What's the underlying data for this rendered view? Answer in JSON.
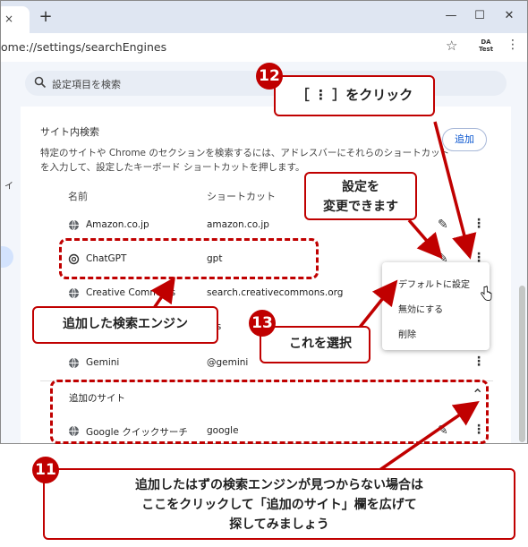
{
  "browser": {
    "url": "ome://settings/searchEngines",
    "new_tab": "+",
    "tab_close": "×",
    "window_controls": {
      "minimize": "—",
      "maximize": "☐",
      "close": "✕"
    },
    "extension_badge": "DA\nTest"
  },
  "search": {
    "placeholder": "設定項目を検索"
  },
  "sidebar_fragment": "イ",
  "site_search": {
    "title": "サイト内検索",
    "description": "特定のサイトや Chrome のセクションを検索するには、アドレスバーにそれらのショートカットを入力して、設定したキーボード ショートカットを押します。",
    "add_button": "追加",
    "columns": {
      "name": "名前",
      "shortcut": "ショートカット"
    },
    "rows": [
      {
        "name": "Amazon.co.jp",
        "shortcut": "amazon.co.jp",
        "icon": "globe-icon"
      },
      {
        "name": "ChatGPT",
        "shortcut": "gpt",
        "icon": "chatgpt-icon"
      },
      {
        "name": "Creative Commons",
        "shortcut": "search.creativecommons.org",
        "icon": "globe-icon"
      },
      {
        "name": "",
        "shortcut": "rds",
        "icon": "globe-icon"
      },
      {
        "name": "Gemini",
        "shortcut": "@gemini",
        "icon": "globe-icon"
      }
    ],
    "added_sites": {
      "header": "追加のサイト",
      "rows": [
        {
          "name": "Google クイックサーチ",
          "shortcut": "google",
          "icon": "globe-icon"
        }
      ]
    }
  },
  "context_menu": {
    "items": [
      "デフォルトに設定",
      "無効にする",
      "削除"
    ]
  },
  "annotations": {
    "n12": {
      "number": "12",
      "text": "［ ⋮ ］をクリック"
    },
    "edit_note": {
      "line1": "設定を",
      "line2": "変更できます"
    },
    "added_engine": {
      "text": "追加した検索エンジン"
    },
    "n13": {
      "number": "13",
      "text": "これを選択"
    },
    "n11": {
      "number": "11",
      "line1": "追加したはずの検索エンジンが見つからない場合は",
      "line2": "ここをクリックして「追加のサイト」欄を広げて",
      "line3": "探してみましょう"
    },
    "accent_color": "#c00000"
  }
}
